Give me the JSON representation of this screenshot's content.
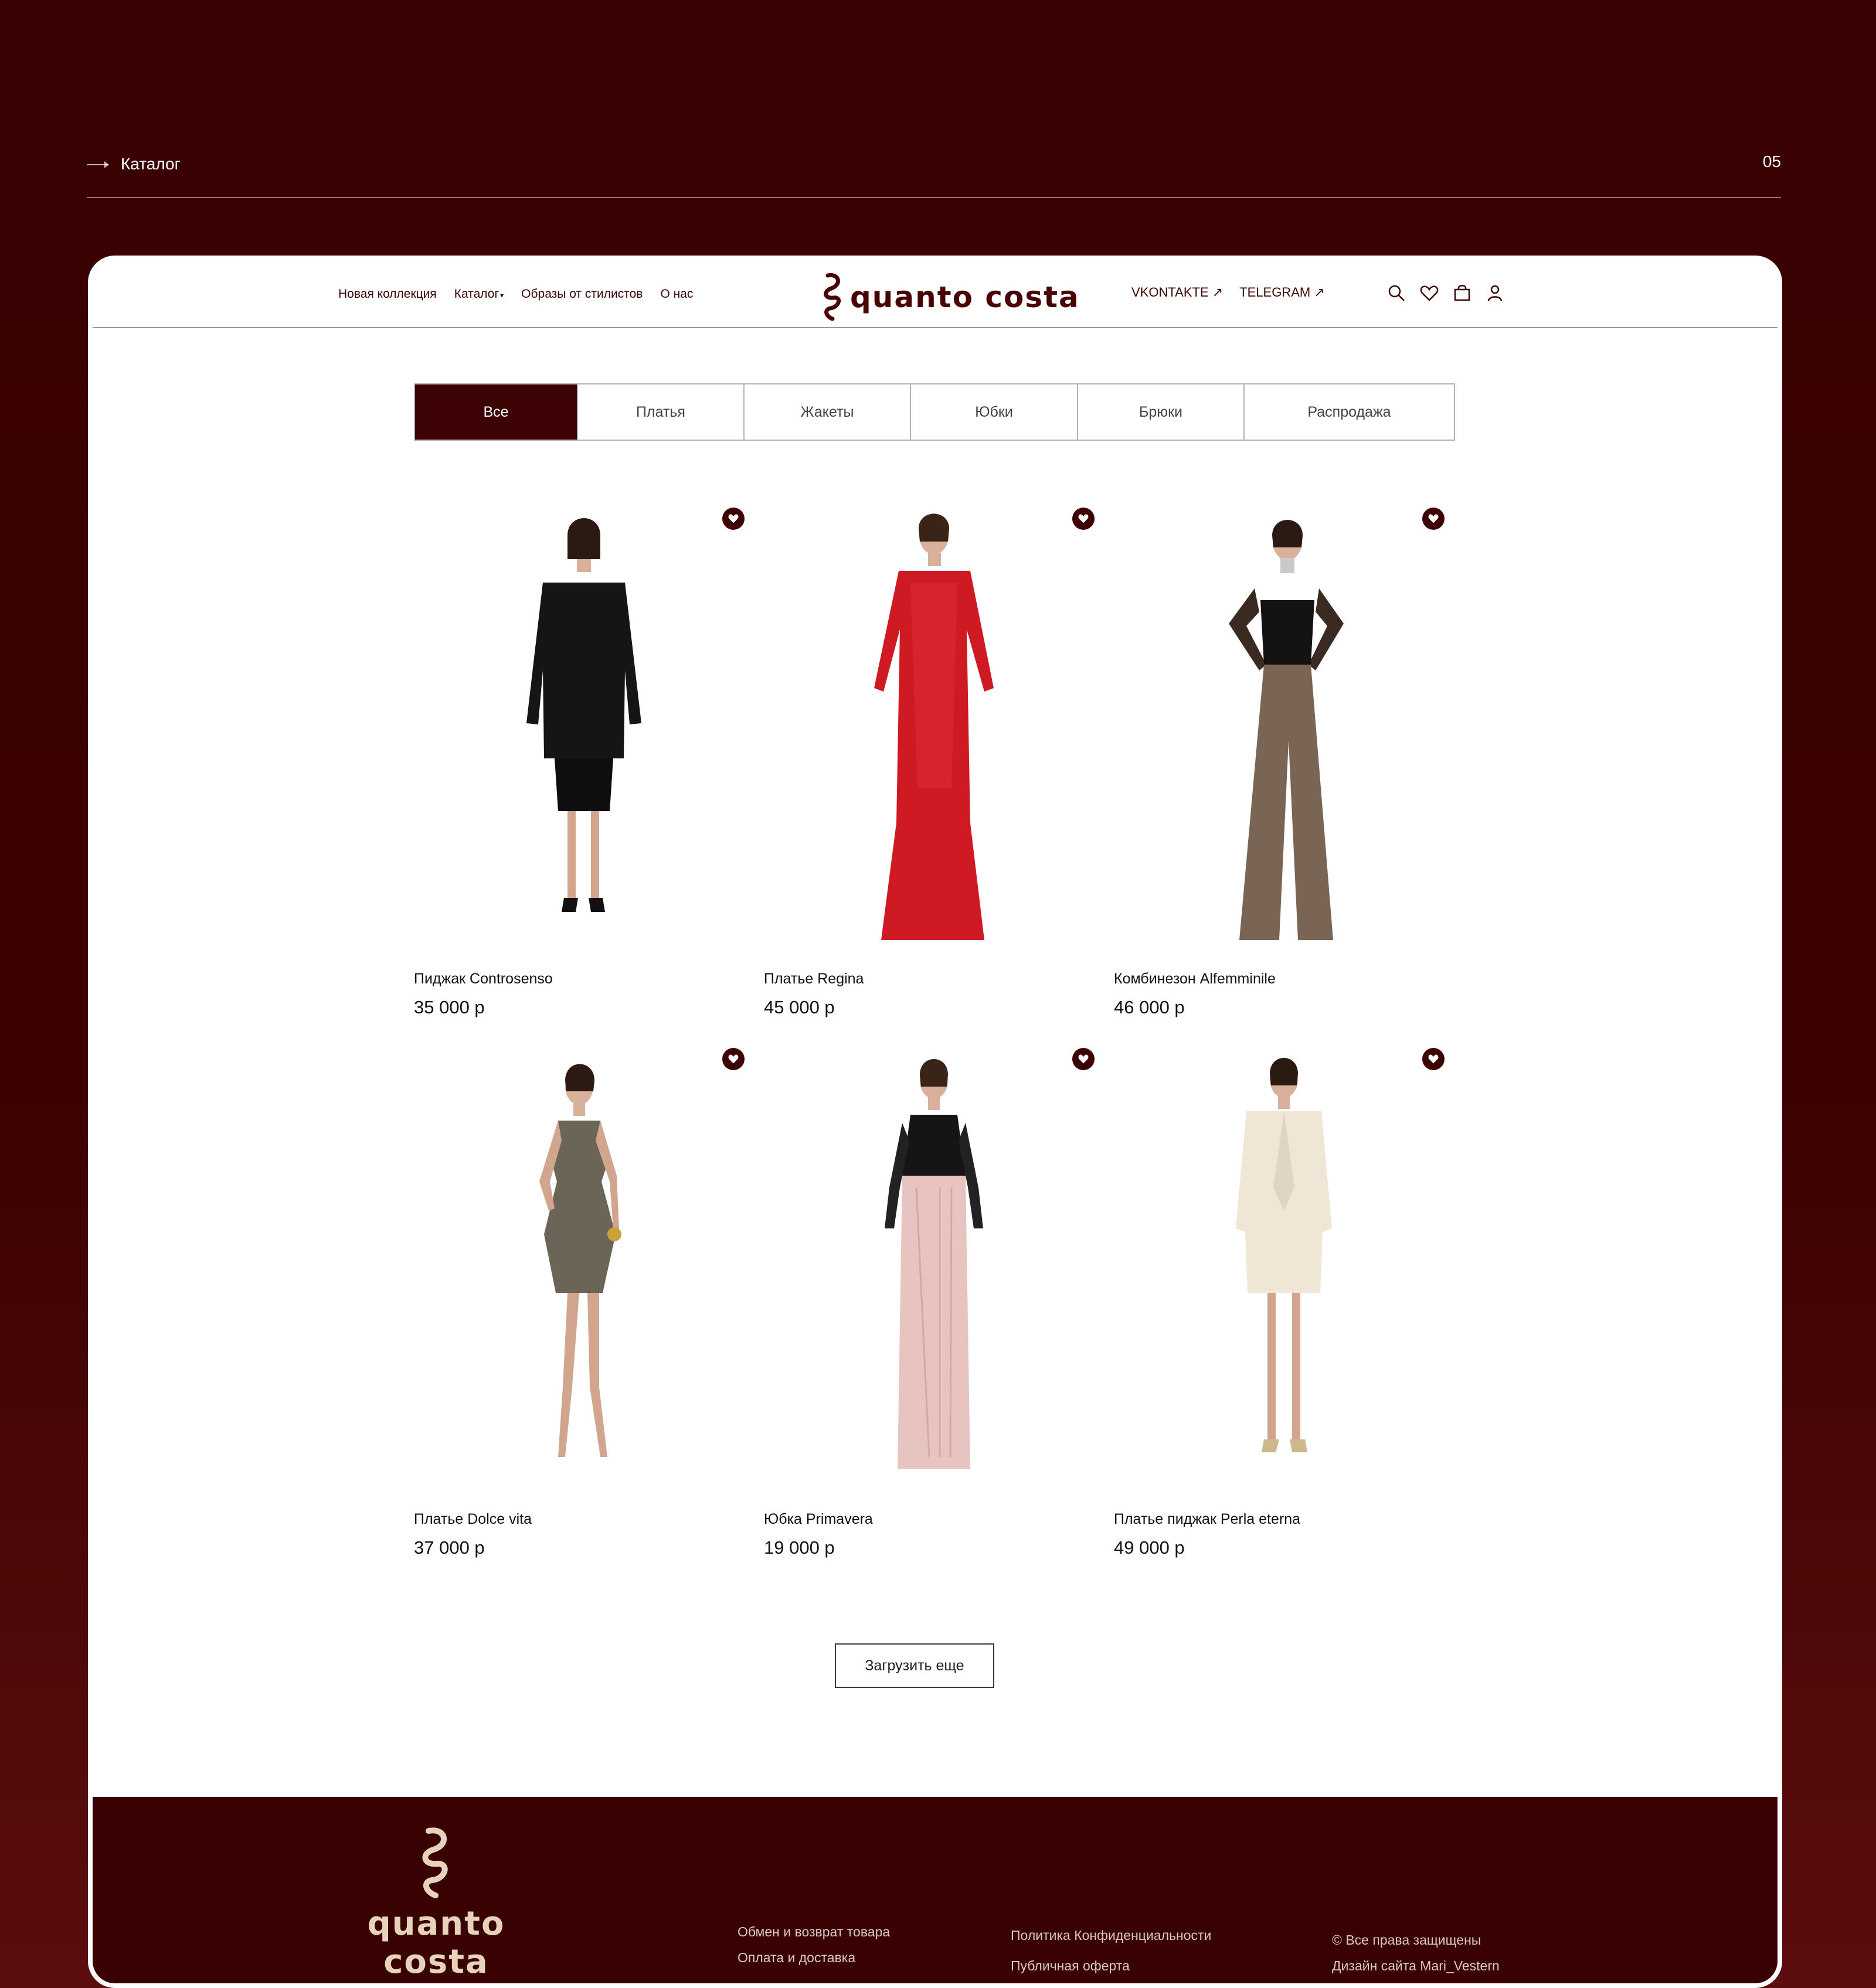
{
  "slide": {
    "title": "Каталог",
    "number": "05"
  },
  "header": {
    "nav": [
      "Новая коллекция",
      "Каталог",
      "Образы от стилистов",
      "О нас"
    ],
    "logo_text": "quanto costa",
    "social": [
      "VKONTAKTE ↗",
      "TELEGRAM ↗"
    ],
    "icons": [
      "search-icon",
      "heart-icon",
      "bag-icon",
      "user-icon"
    ]
  },
  "tabs": [
    "Все",
    "Платья",
    "Жакеты",
    "Юбки",
    "Брюки",
    "Распродажа"
  ],
  "active_tab": "Все",
  "products": [
    {
      "name": "Пиджак Controsenso",
      "price": "35 000 р"
    },
    {
      "name": "Платье Regina",
      "price": "45 000 р"
    },
    {
      "name": "Комбинезон Alfemminile",
      "price": "46 000 р"
    },
    {
      "name": "Платье Dolce vita",
      "price": "37 000 р"
    },
    {
      "name": "Юбка Primavera",
      "price": "19 000 р"
    },
    {
      "name": "Платье пиджак Perla eterna",
      "price": "49 000 р"
    }
  ],
  "load_more": "Загрузить еще",
  "footer": {
    "logo_text": "quanto costa",
    "col1": [
      "Обмен и возврат товара",
      "Оплата и доставка"
    ],
    "col2": [
      "Политика Конфиденциальности",
      "Публичная оферта"
    ],
    "col3": [
      "© Все права защищены",
      "Дизайн сайта Mari_Vestern"
    ]
  },
  "colors": {
    "brand": "#3d0304",
    "background": "#3a0102",
    "footer_text": "#e6d3ba"
  }
}
